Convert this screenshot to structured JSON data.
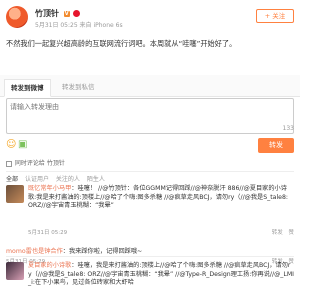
{
  "post": {
    "author": "竹顶针",
    "vip_label": "V",
    "meta": "5月31日 05:25 来自 iPhone 6s",
    "follow_label": "+ 关注",
    "body": "不然我们一起复兴超高龄的互联网流行词吧。本周就从“哇噻”开始好了。"
  },
  "share_tabs": {
    "weibo": "转发到微博",
    "private": "转发到私信"
  },
  "repost": {
    "placeholder": "请输入转发理由",
    "char_count": "133",
    "button_label": "转发"
  },
  "options": {
    "also_comment": "同时评论给",
    "also_comment_target": "竹顶针"
  },
  "filters": [
    "全部",
    "认证用户",
    "关注的人",
    "陌生人"
  ],
  "comments": [
    {
      "user": "既忆常年小马甲",
      "text": "：哇噻！ //@竹顶针：各位GGMM记得回踩//@神奈脱汗 886//@夏目家的小诗歌:我是来打酱油的:顶楼上//@哈了个嗨:图多杀糖 //@疯草走风BCJ，请勿ry（//@我是S_tale8: ORZ//@宇宙青玉桃糊：“我晕”",
      "time": "5月31日 05:29",
      "actions": [
        "转发",
        "赞"
      ]
    },
    {
      "user": "momo雷也是钟合作",
      "text": "：我来踩你啦，记得回踩哦~",
      "time": "5月31日 05:29",
      "actions": [
        "转发",
        "赞"
      ]
    },
    {
      "user": "夏目家的小诗歌",
      "text": "：哇噻，我是来打酱油的:顶楼上//@哈了个嗨:图多杀糖 //@疯草走风BCJ，请勿ry（//@我是S_tale8: ORZ//@宇宙青玉桃糊：“我晕” //@Type-R_Design理工扬:你再说//@_LMI_i:在下小果鸟，见过各位砖家和大虾哈",
      "time": "5月31日 05:29",
      "actions": [
        "转发",
        "赞"
      ]
    }
  ],
  "colors": {
    "accent": "#ff8140",
    "link": "#eb7350",
    "muted": "#999999"
  }
}
